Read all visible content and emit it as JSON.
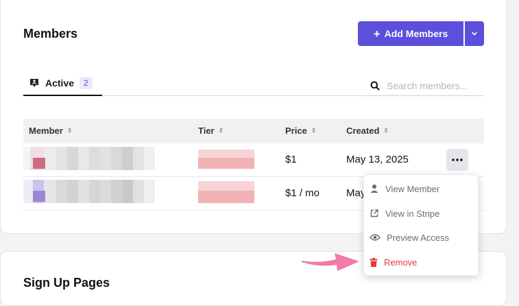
{
  "members": {
    "title": "Members",
    "add_button": "Add Members",
    "tab": {
      "label": "Active",
      "count": "2"
    },
    "search_placeholder": "Search members...",
    "columns": {
      "member": "Member",
      "tier": "Tier",
      "price": "Price",
      "created": "Created"
    },
    "rows": [
      {
        "price": "$1",
        "created": "May 13, 2025"
      },
      {
        "price": "$1 / mo",
        "created": "May"
      }
    ]
  },
  "menu": {
    "view_member": "View Member",
    "view_stripe": "View in Stripe",
    "preview_access": "Preview Access",
    "remove": "Remove"
  },
  "next_section": {
    "title": "Sign Up Pages"
  },
  "colors": {
    "accent": "#5b4fdb",
    "danger": "#e23b3b",
    "arrow": "#f27aa6"
  }
}
